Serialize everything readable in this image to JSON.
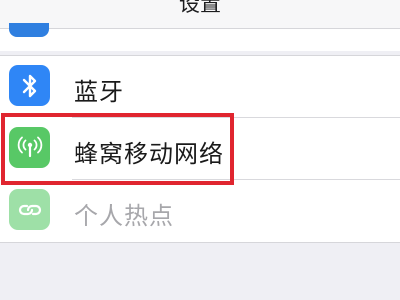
{
  "nav": {
    "title": "设置"
  },
  "settings": {
    "rows": [
      {
        "label": "蓝牙",
        "icon": "bluetooth-icon"
      },
      {
        "label": "蜂窝移动网络",
        "icon": "cellular-antenna-icon"
      },
      {
        "label": "个人热点",
        "icon": "personal-hotspot-icon"
      }
    ]
  },
  "colors": {
    "bluetooth": "#2f86f6",
    "cellular": "#58c866",
    "hotspot": "#9ee0a7",
    "highlight": "#e0252f"
  }
}
